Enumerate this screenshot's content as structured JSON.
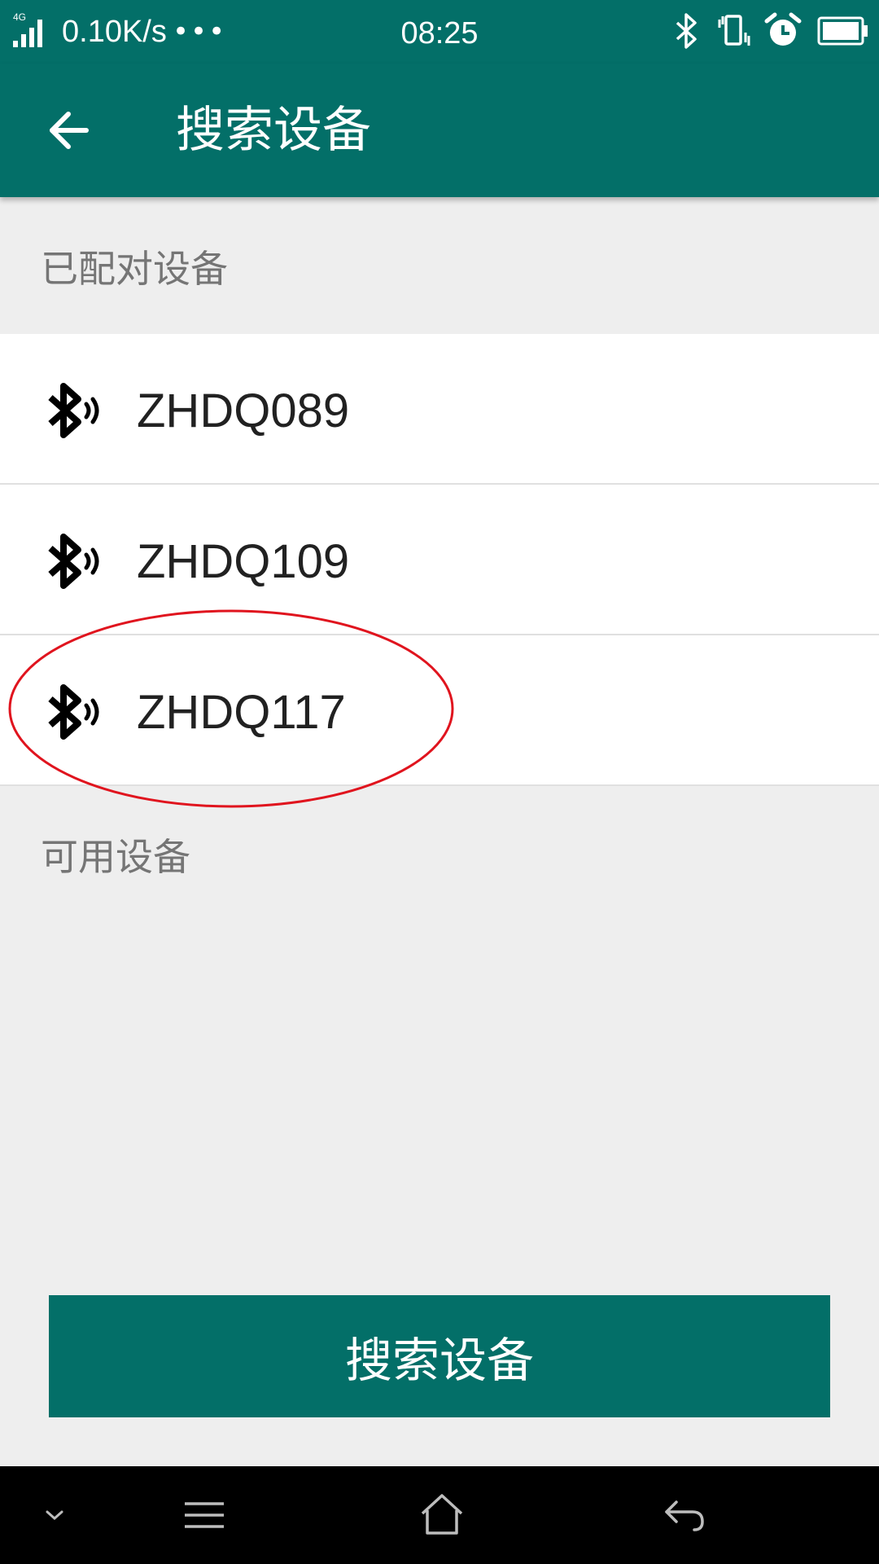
{
  "status_bar": {
    "network_type": "4G",
    "net_speed": "0.10K/s",
    "more_dots": "•••",
    "time": "08:25",
    "icons": [
      "signal-icon",
      "bluetooth-icon",
      "vibrate-icon",
      "alarm-icon",
      "battery-icon"
    ]
  },
  "app_bar": {
    "title": "搜索设备",
    "back_icon": "arrow-left-icon"
  },
  "paired_section": {
    "header": "已配对设备",
    "devices": [
      {
        "name": "ZHDQ089",
        "icon": "bluetooth-signal-icon"
      },
      {
        "name": "ZHDQ109",
        "icon": "bluetooth-signal-icon"
      },
      {
        "name": "ZHDQ117",
        "icon": "bluetooth-signal-icon"
      }
    ]
  },
  "available_section": {
    "header": "可用设备"
  },
  "search_button": {
    "label": "搜索设备"
  },
  "nav_bar": {
    "icons": [
      "chevron-down-icon",
      "menu-icon",
      "home-icon",
      "back-icon"
    ]
  },
  "colors": {
    "primary": "#036f68",
    "background": "#eeeeee",
    "list_background": "#ffffff",
    "section_text": "#757575",
    "item_text": "#212121",
    "highlight": "#e0141e"
  }
}
